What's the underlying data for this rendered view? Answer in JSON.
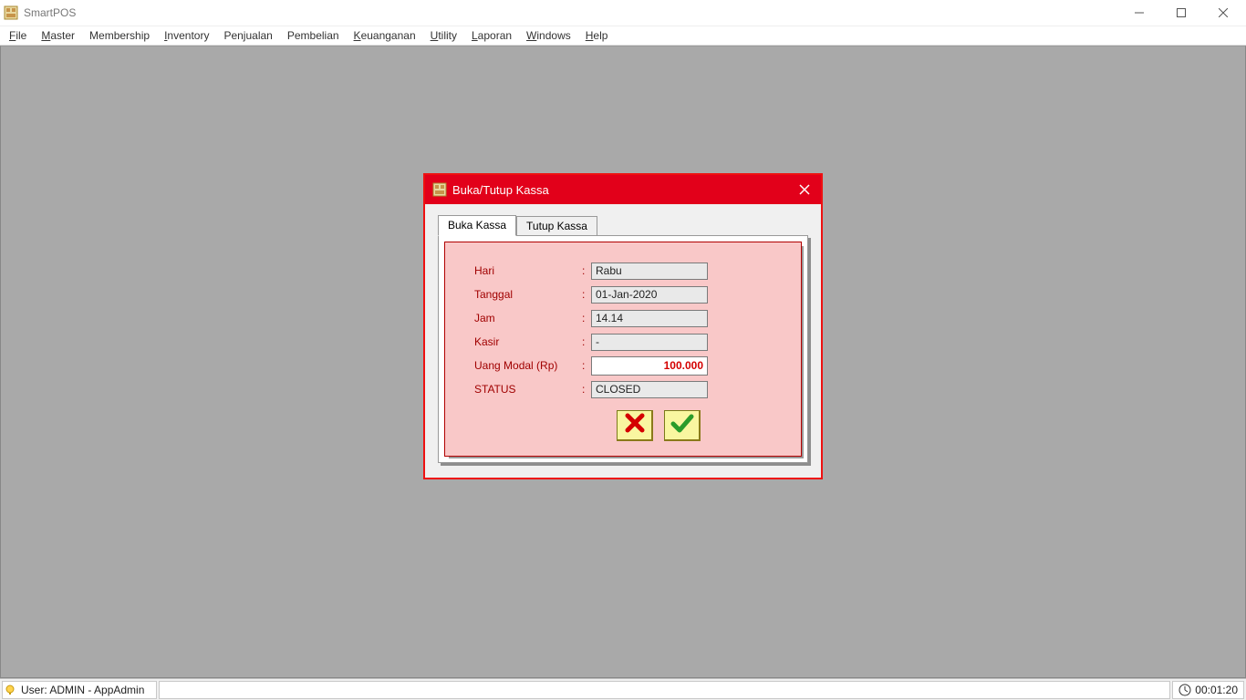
{
  "window": {
    "title": "SmartPOS"
  },
  "menu": {
    "items": [
      {
        "u": "F",
        "rest": "ile"
      },
      {
        "u": "M",
        "rest": "aster"
      },
      {
        "u": "",
        "rest": "Membership"
      },
      {
        "u": "I",
        "rest": "nventory"
      },
      {
        "u": "",
        "rest": "Penjualan"
      },
      {
        "u": "",
        "rest": "Pembelian"
      },
      {
        "u": "K",
        "rest": "euanganan"
      },
      {
        "u": "U",
        "rest": "tility"
      },
      {
        "u": "L",
        "rest": "aporan"
      },
      {
        "u": "W",
        "rest": "indows"
      },
      {
        "u": "H",
        "rest": "elp"
      }
    ]
  },
  "dialog": {
    "title": "Buka/Tutup Kassa",
    "tabs": {
      "active": "Buka Kassa",
      "inactive": "Tutup Kassa"
    },
    "fields": {
      "hari": {
        "label": "Hari",
        "value": "Rabu"
      },
      "tanggal": {
        "label": "Tanggal",
        "value": "01-Jan-2020"
      },
      "jam": {
        "label": "Jam",
        "value": "14.14"
      },
      "kasir": {
        "label": "Kasir",
        "value": "-"
      },
      "uang_modal": {
        "label": "Uang Modal (Rp)",
        "value": "100.000"
      },
      "status": {
        "label": "STATUS",
        "value": "CLOSED"
      }
    }
  },
  "statusbar": {
    "user": "User: ADMIN - AppAdmin",
    "time": "00:01:20"
  }
}
